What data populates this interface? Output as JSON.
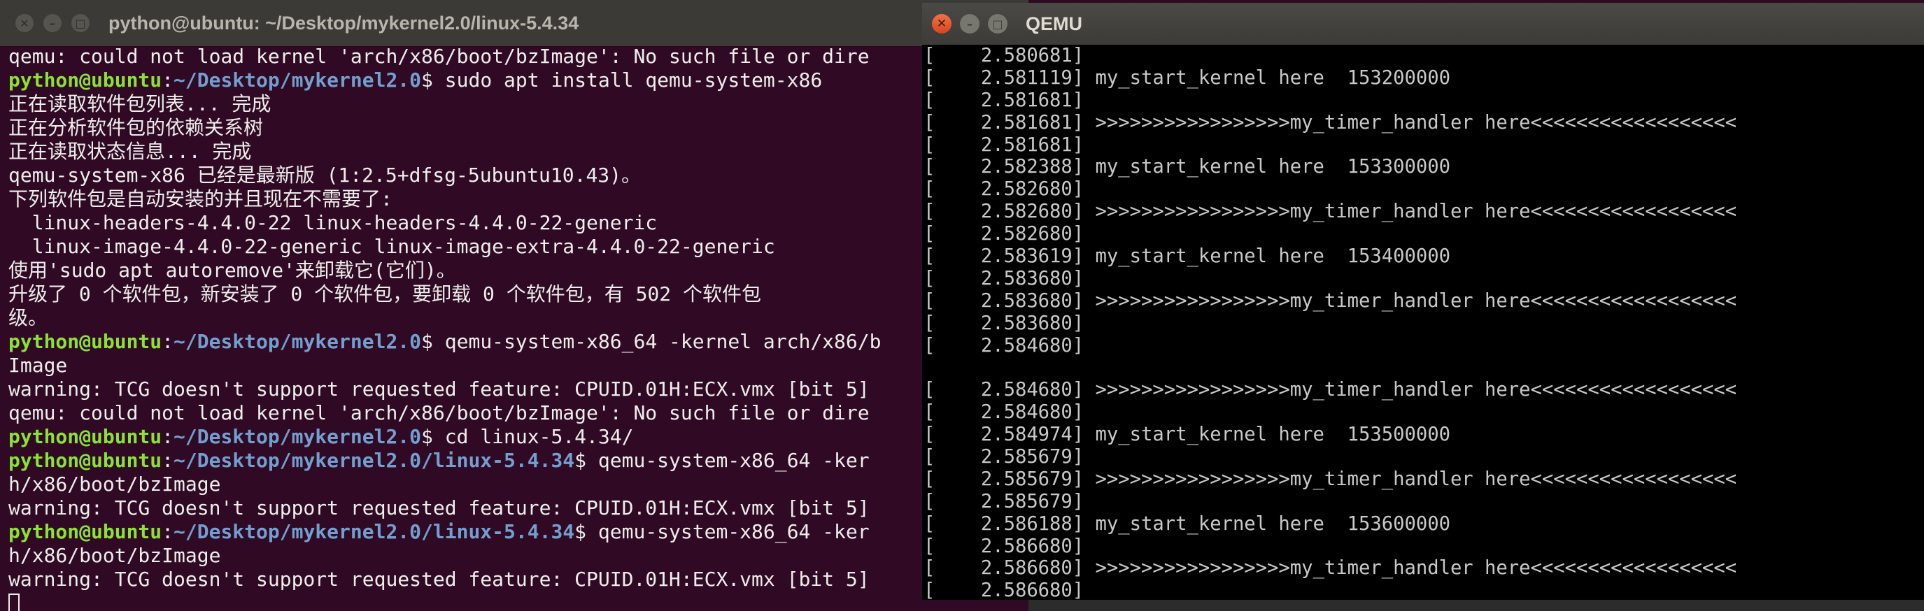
{
  "terminal": {
    "title": "python@ubuntu: ~/Desktop/mykernel2.0/linux-5.4.34",
    "lines": [
      {
        "type": "text",
        "text": "qemu: could not load kernel 'arch/x86/boot/bzImage': No such file or dire"
      },
      {
        "type": "prompt",
        "user": "python@ubuntu",
        "path": "~/Desktop/mykernel2.0",
        "cmd": "$ sudo apt install qemu-system-x86"
      },
      {
        "type": "text",
        "text": "正在读取软件包列表... 完成"
      },
      {
        "type": "text",
        "text": "正在分析软件包的依赖关系树"
      },
      {
        "type": "text",
        "text": "正在读取状态信息... 完成"
      },
      {
        "type": "text",
        "text": "qemu-system-x86 已经是最新版 (1:2.5+dfsg-5ubuntu10.43)。"
      },
      {
        "type": "text",
        "text": "下列软件包是自动安装的并且现在不需要了:"
      },
      {
        "type": "text",
        "text": "  linux-headers-4.4.0-22 linux-headers-4.4.0-22-generic"
      },
      {
        "type": "text",
        "text": "  linux-image-4.4.0-22-generic linux-image-extra-4.4.0-22-generic"
      },
      {
        "type": "text",
        "text": "使用'sudo apt autoremove'来卸载它(它们)。"
      },
      {
        "type": "text",
        "text": "升级了 0 个软件包，新安装了 0 个软件包，要卸载 0 个软件包，有 502 个软件包"
      },
      {
        "type": "text",
        "text": "级。"
      },
      {
        "type": "prompt",
        "user": "python@ubuntu",
        "path": "~/Desktop/mykernel2.0",
        "cmd": "$ qemu-system-x86_64 -kernel arch/x86/b"
      },
      {
        "type": "text",
        "text": "Image"
      },
      {
        "type": "text",
        "text": "warning: TCG doesn't support requested feature: CPUID.01H:ECX.vmx [bit 5]"
      },
      {
        "type": "text",
        "text": "qemu: could not load kernel 'arch/x86/boot/bzImage': No such file or dire"
      },
      {
        "type": "prompt",
        "user": "python@ubuntu",
        "path": "~/Desktop/mykernel2.0",
        "cmd": "$ cd linux-5.4.34/"
      },
      {
        "type": "prompt",
        "user": "python@ubuntu",
        "path": "~/Desktop/mykernel2.0/linux-5.4.34",
        "cmd": "$ qemu-system-x86_64 -ker"
      },
      {
        "type": "text",
        "text": "h/x86/boot/bzImage"
      },
      {
        "type": "text",
        "text": "warning: TCG doesn't support requested feature: CPUID.01H:ECX.vmx [bit 5]"
      },
      {
        "type": "prompt",
        "user": "python@ubuntu",
        "path": "~/Desktop/mykernel2.0/linux-5.4.34",
        "cmd": "$ qemu-system-x86_64 -ker"
      },
      {
        "type": "text",
        "text": "h/x86/boot/bzImage"
      },
      {
        "type": "text",
        "text": "warning: TCG doesn't support requested feature: CPUID.01H:ECX.vmx [bit 5]"
      }
    ]
  },
  "qemu": {
    "title": "QEMU",
    "console": [
      "[    2.580681]",
      "[    2.581119] my_start_kernel here  153200000",
      "[    2.581681]",
      "[    2.581681] >>>>>>>>>>>>>>>>>my_timer_handler here<<<<<<<<<<<<<<<<<<",
      "[    2.581681]",
      "[    2.582388] my_start_kernel here  153300000",
      "[    2.582680]",
      "[    2.582680] >>>>>>>>>>>>>>>>>my_timer_handler here<<<<<<<<<<<<<<<<<<",
      "[    2.582680]",
      "[    2.583619] my_start_kernel here  153400000",
      "[    2.583680]",
      "[    2.583680] >>>>>>>>>>>>>>>>>my_timer_handler here<<<<<<<<<<<<<<<<<<",
      "[    2.583680]",
      "[    2.584680]",
      "",
      "[    2.584680] >>>>>>>>>>>>>>>>>my_timer_handler here<<<<<<<<<<<<<<<<<<",
      "[    2.584680]",
      "[    2.584974] my_start_kernel here  153500000",
      "[    2.585679]",
      "[    2.585679] >>>>>>>>>>>>>>>>>my_timer_handler here<<<<<<<<<<<<<<<<<<",
      "[    2.585679]",
      "[    2.586188] my_start_kernel here  153600000",
      "[    2.586680]",
      "[    2.586680] >>>>>>>>>>>>>>>>>my_timer_handler here<<<<<<<<<<<<<<<<<<",
      "[    2.586680]"
    ]
  }
}
